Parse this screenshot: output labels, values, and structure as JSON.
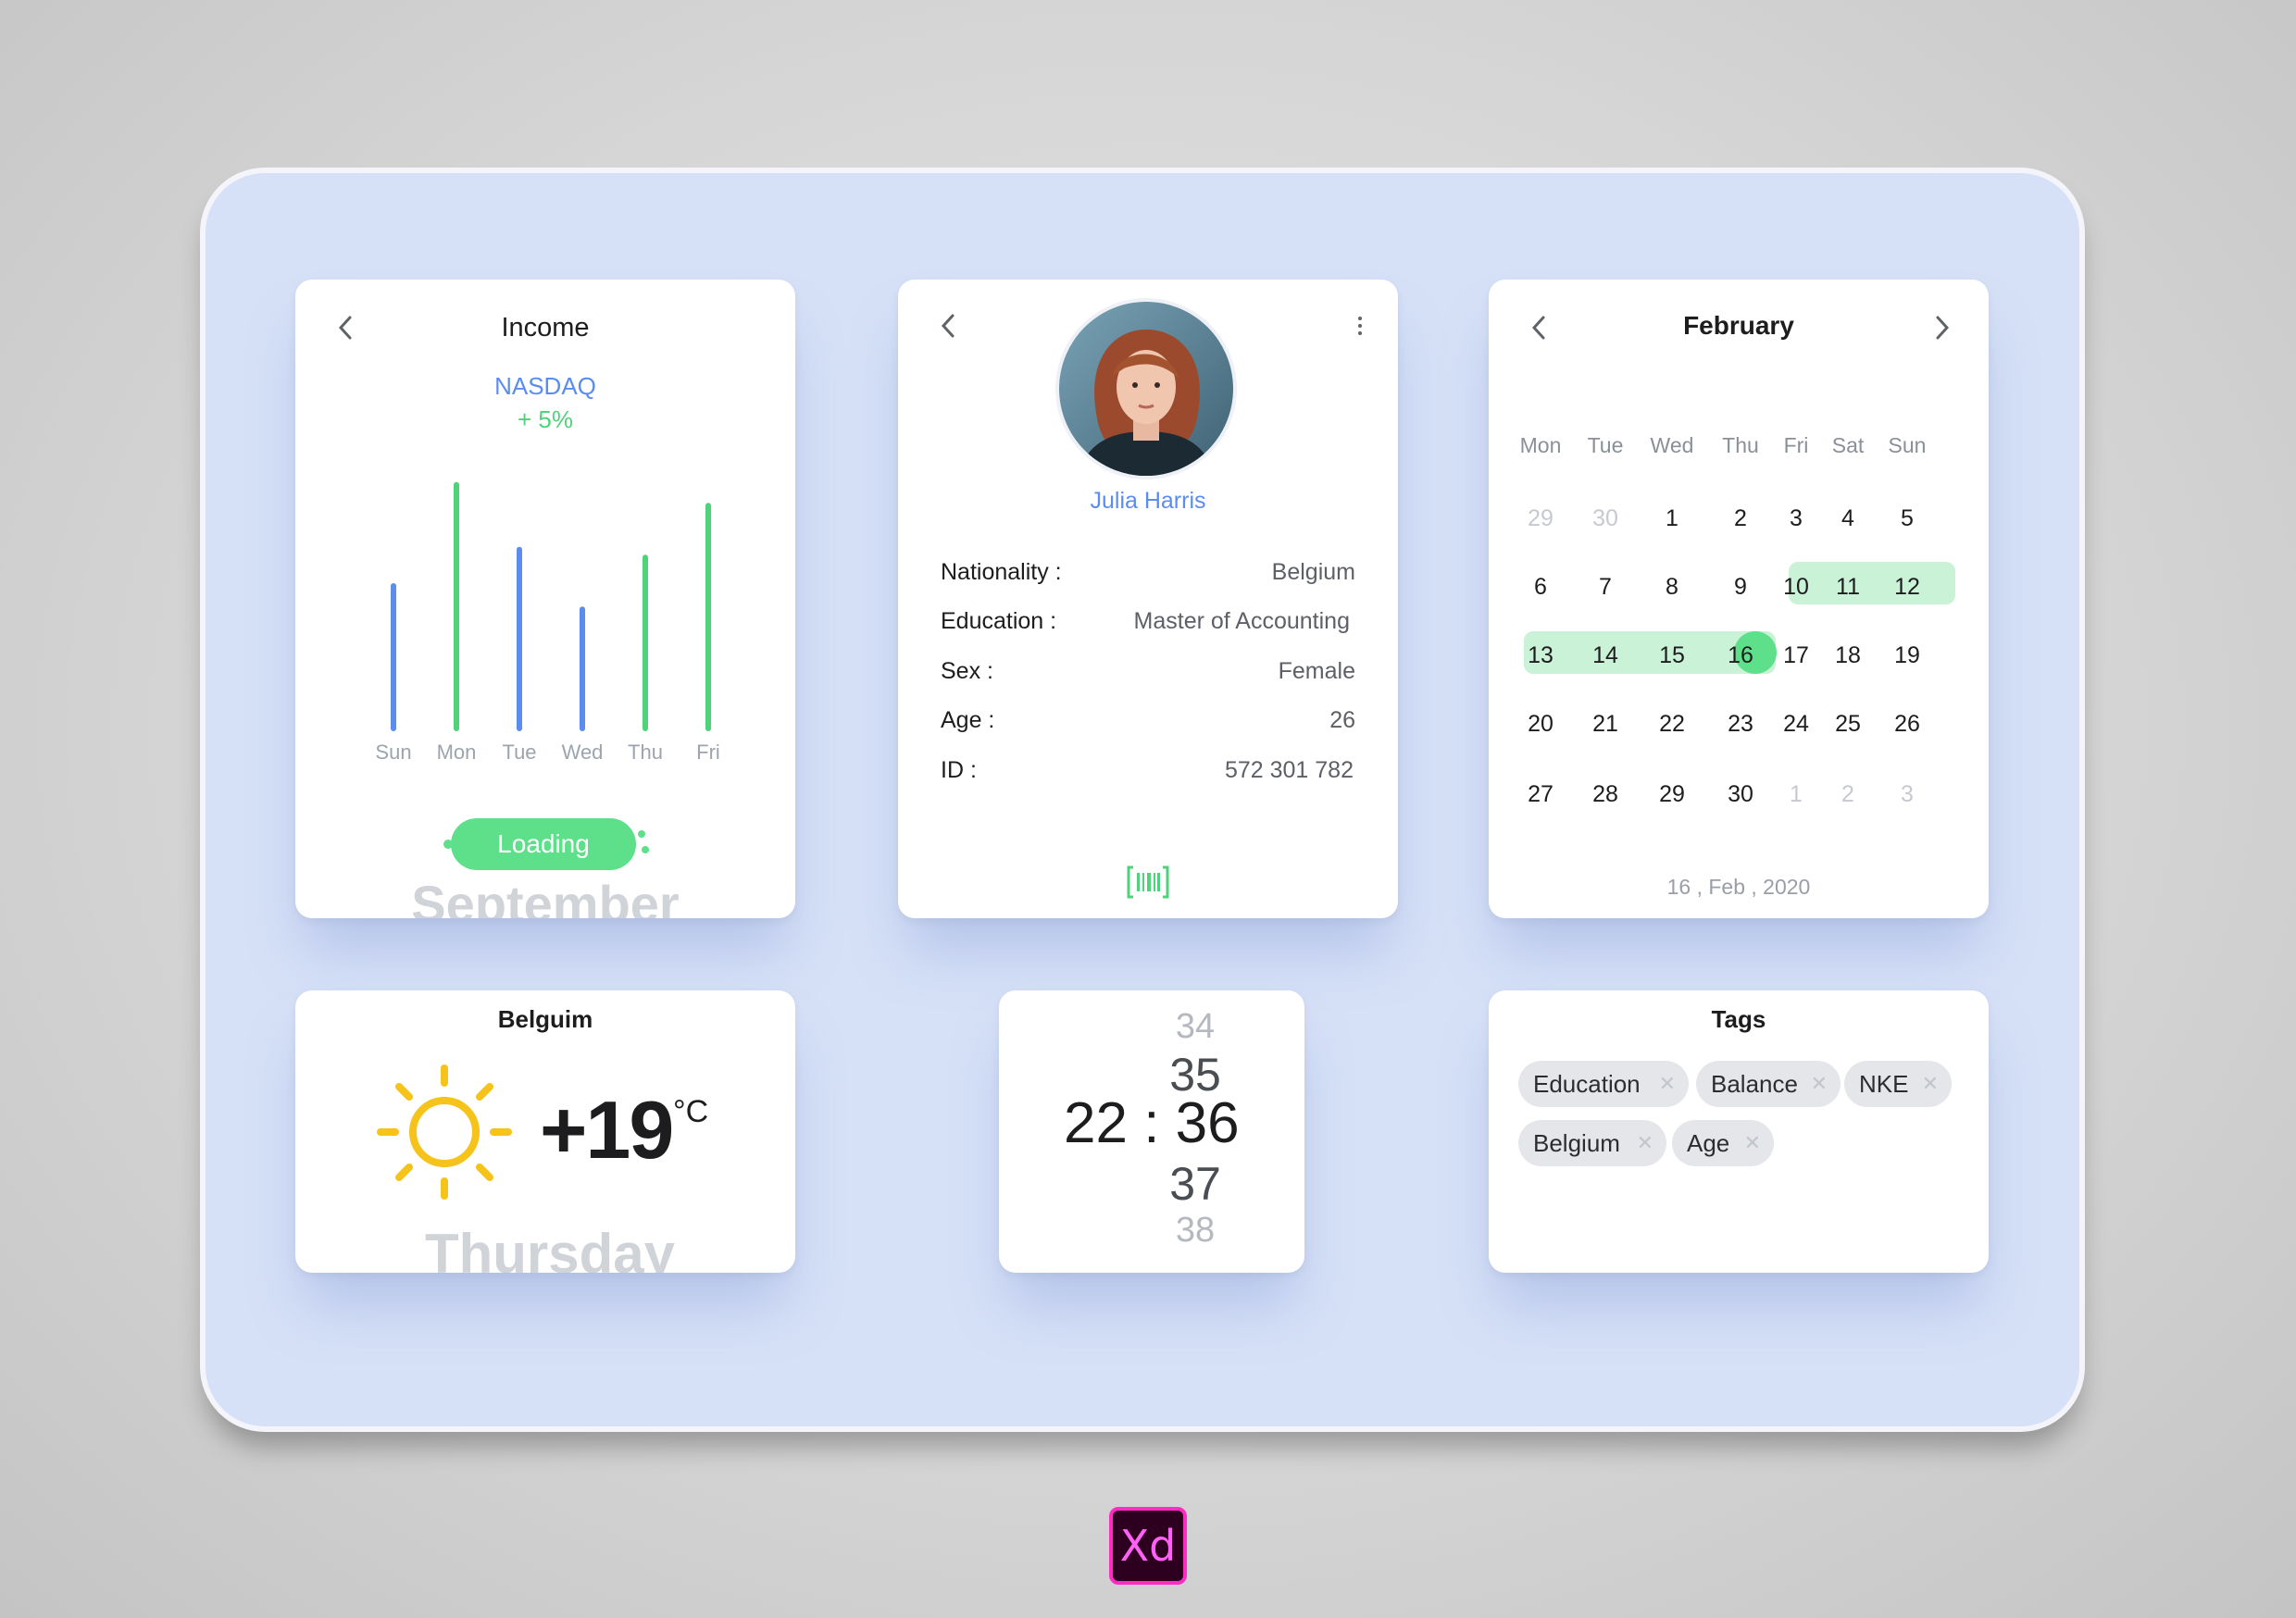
{
  "income": {
    "title": "Income",
    "market": "NASDAQ",
    "change": "+ 5%",
    "button_label": "Loading",
    "ghost_text": "September",
    "colors": {
      "blue": "#5b8df0",
      "green": "#4ed37b"
    }
  },
  "chart_data": {
    "type": "bar",
    "categories": [
      "Sun",
      "Mon",
      "Tue",
      "Wed",
      "Thu",
      "Fri"
    ],
    "values": [
      55,
      94,
      69,
      46,
      66,
      86
    ],
    "series_colors": [
      "blue",
      "green",
      "blue",
      "blue",
      "green",
      "green"
    ],
    "ylim": [
      0,
      100
    ],
    "grid": false,
    "title": "",
    "xlabel": "",
    "ylabel": ""
  },
  "profile": {
    "name": "Julia Harris",
    "fields": [
      {
        "label": "Nationality :",
        "value": "Belgium"
      },
      {
        "label": "Education :",
        "value": "Master of Accounting"
      },
      {
        "label": "Sex :",
        "value": "Female"
      },
      {
        "label": "Age :",
        "value": "26"
      },
      {
        "label": "ID :",
        "value": "572 301 782"
      }
    ],
    "icons": [
      "chevron-left-icon",
      "more-vertical-icon",
      "barcode-icon"
    ]
  },
  "calendar": {
    "month": "February",
    "weekdays": [
      "Mon",
      "Tue",
      "Wed",
      "Thu",
      "Fri",
      "Sat",
      "Sun"
    ],
    "weeks": [
      [
        "29",
        "30",
        "1",
        "2",
        "3",
        "4",
        "5"
      ],
      [
        "6",
        "7",
        "8",
        "9",
        "10",
        "11",
        "12"
      ],
      [
        "13",
        "14",
        "15",
        "16",
        "17",
        "18",
        "19"
      ],
      [
        "20",
        "21",
        "22",
        "23",
        "24",
        "25",
        "26"
      ],
      [
        "27",
        "28",
        "29",
        "30",
        "1",
        "2",
        "3"
      ]
    ],
    "selected": "16",
    "highlight_range": "10 - 16",
    "footer_date": "16 , Feb , 2020",
    "highlight_color": "#c9f2d6",
    "selected_color": "#5ee08a"
  },
  "weather": {
    "city": "Belguim",
    "temperature": "+19",
    "unit": "°C",
    "ghost_text": "Thursday",
    "icon": "sun-icon",
    "sun_color": "#f6c31a"
  },
  "time": {
    "hours": "22",
    "separator": ":",
    "minutes": "36",
    "above": [
      "34",
      "35"
    ],
    "below": [
      "37",
      "38"
    ]
  },
  "tags": {
    "title": "Tags",
    "items": [
      "Education",
      "Balance",
      "NKE",
      "Belgium",
      "Age"
    ],
    "remove_symbol": "✕"
  },
  "footer": {
    "app_badge": "Xd"
  }
}
